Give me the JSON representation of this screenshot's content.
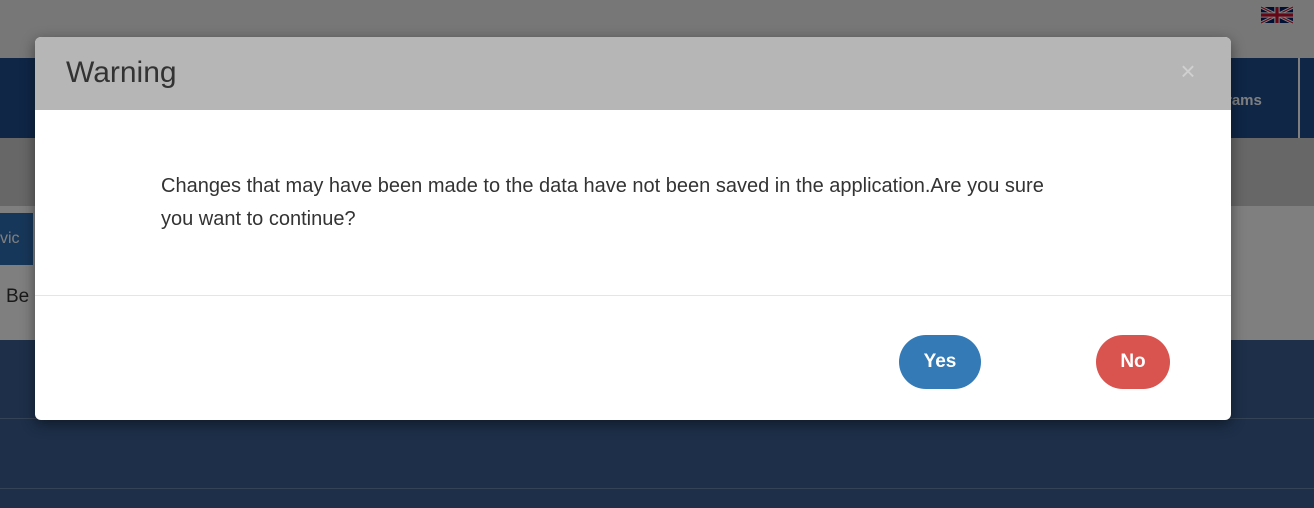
{
  "background": {
    "nav_item": "rams",
    "side_tab": "vic",
    "side_text": "Be"
  },
  "modal": {
    "title": "Warning",
    "close_symbol": "×",
    "message": "Changes that may have been made to the data have not been saved in the application.Are you sure you want to continue?",
    "yes_label": "Yes",
    "no_label": "No"
  },
  "colors": {
    "header_bg": "#b6b6b6",
    "yes_button": "#337ab7",
    "no_button": "#d9534f"
  },
  "icons": {
    "flag": "uk-flag-icon",
    "close": "close-icon"
  }
}
